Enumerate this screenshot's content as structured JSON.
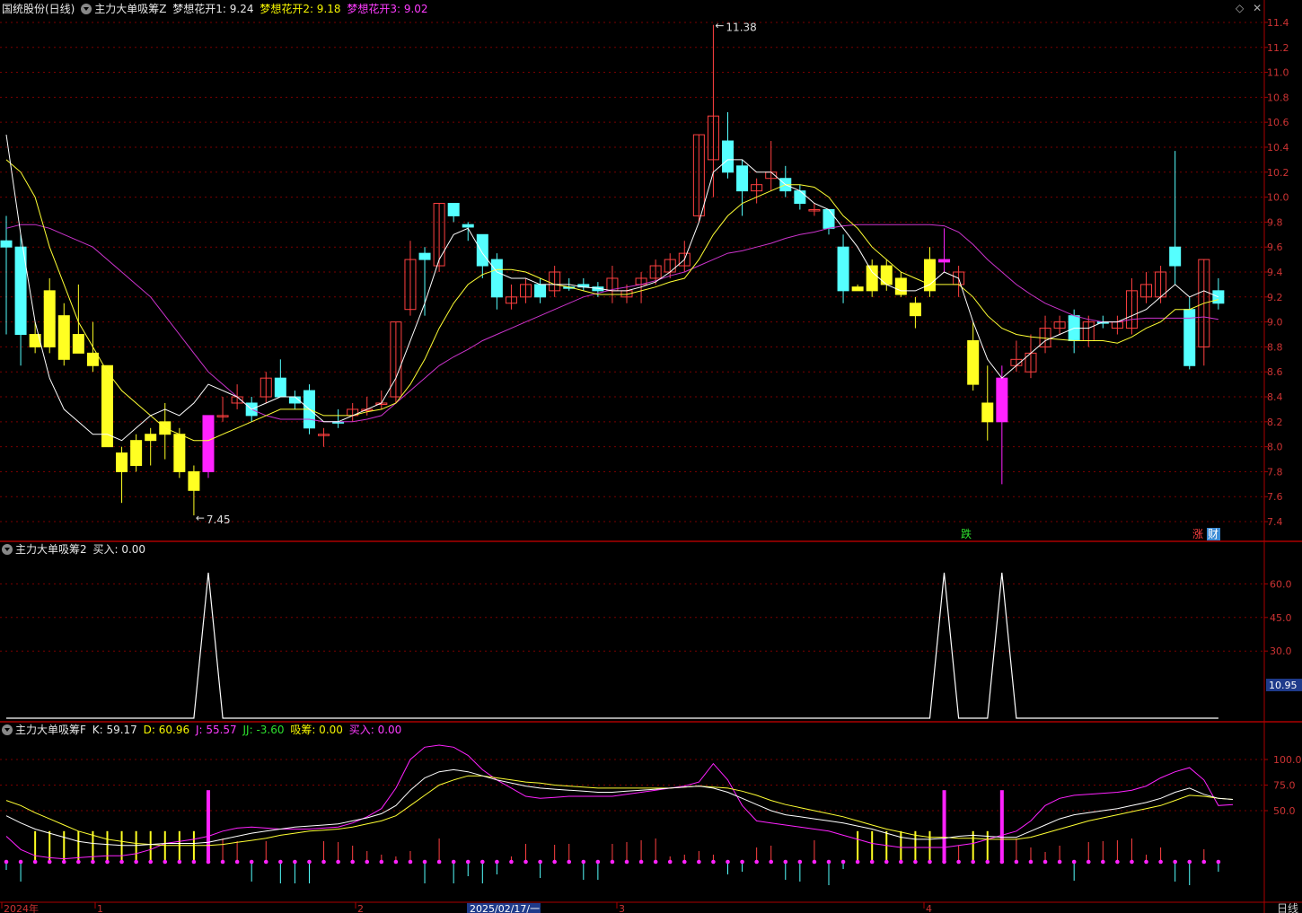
{
  "panel1": {
    "stock_name": "国统股份(日线)",
    "indicator_name": "主力大单吸筹Z",
    "ma1_label": "梦想花开1: 9.24",
    "ma2_label": "梦想花开2: 9.18",
    "ma3_label": "梦想花开3: 9.02",
    "high_marker": "11.38",
    "low_marker": "7.45",
    "y_ticks": [
      "11.4",
      "11.2",
      "11.0",
      "10.8",
      "10.6",
      "10.4",
      "10.2",
      "10.0",
      "9.8",
      "9.6",
      "9.4",
      "9.2",
      "9.0",
      "8.8",
      "8.6",
      "8.4",
      "8.2",
      "8.0",
      "7.8",
      "7.6",
      "7.4"
    ],
    "tag_die": "跌",
    "tag_zhang": "涨",
    "tag_cai": "财"
  },
  "panel2": {
    "indicator_name": "主力大单吸筹2",
    "buy_label": "买入: 0.00",
    "y_ticks": [
      "60.0",
      "45.0",
      "30.0"
    ],
    "current_value": "10.95"
  },
  "panel3": {
    "indicator_name": "主力大单吸筹F",
    "k_label": "K: 59.17",
    "d_label": "D: 60.96",
    "j_label": "J: 55.57",
    "jj_label": "JJ: -3.60",
    "xichou_label": "吸筹: 0.00",
    "buy_label": "买入: 0.00",
    "y_ticks": [
      "100.0",
      "75.0",
      "50.0"
    ]
  },
  "xaxis": {
    "labels": [
      "2024年",
      "1",
      "2",
      "2025/02/17/一",
      "3",
      "4"
    ],
    "period": "日线"
  },
  "colors": {
    "up": "#ff4040",
    "down": "#55ffff",
    "yellow_bar": "#ffff22",
    "magenta_bar": "#ff22ff",
    "ma1": "#ffffff",
    "ma2": "#ffff33",
    "ma3": "#cc33cc",
    "grid": "#7a0000"
  },
  "chart_data": {
    "type": "candlestick",
    "ylim": [
      7.35,
      11.45
    ],
    "candles": [
      {
        "o": 9.65,
        "h": 9.85,
        "l": 8.9,
        "c": 9.6,
        "k": "cyan"
      },
      {
        "o": 9.6,
        "h": 9.7,
        "l": 8.65,
        "c": 8.9,
        "k": "cyan"
      },
      {
        "o": 8.9,
        "h": 9.0,
        "l": 8.75,
        "c": 8.8,
        "k": "yellow"
      },
      {
        "o": 9.25,
        "h": 9.35,
        "l": 8.75,
        "c": 8.8,
        "k": "yellow"
      },
      {
        "o": 9.05,
        "h": 9.15,
        "l": 8.65,
        "c": 8.7,
        "k": "yellow"
      },
      {
        "o": 8.9,
        "h": 9.3,
        "l": 8.8,
        "c": 8.75,
        "k": "yellow"
      },
      {
        "o": 8.75,
        "h": 9.0,
        "l": 8.6,
        "c": 8.65,
        "k": "yellow"
      },
      {
        "o": 8.65,
        "h": 8.65,
        "l": 8.0,
        "c": 8.0,
        "k": "yellow"
      },
      {
        "o": 7.95,
        "h": 8.0,
        "l": 7.55,
        "c": 7.8,
        "k": "yellow"
      },
      {
        "o": 8.05,
        "h": 8.1,
        "l": 7.8,
        "c": 7.85,
        "k": "yellow"
      },
      {
        "o": 8.1,
        "h": 8.15,
        "l": 7.85,
        "c": 8.05,
        "k": "yellow"
      },
      {
        "o": 8.2,
        "h": 8.35,
        "l": 7.9,
        "c": 8.1,
        "k": "yellow"
      },
      {
        "o": 8.1,
        "h": 8.15,
        "l": 7.75,
        "c": 7.8,
        "k": "yellow"
      },
      {
        "o": 7.8,
        "h": 7.85,
        "l": 7.45,
        "c": 7.65,
        "k": "yellow"
      },
      {
        "o": 7.8,
        "h": 8.25,
        "l": 7.75,
        "c": 8.25,
        "k": "magenta"
      },
      {
        "o": 8.25,
        "h": 8.4,
        "l": 8.2,
        "c": 8.25,
        "k": "up"
      },
      {
        "o": 8.35,
        "h": 8.5,
        "l": 8.3,
        "c": 8.4,
        "k": "up"
      },
      {
        "o": 8.35,
        "h": 8.4,
        "l": 8.2,
        "c": 8.25,
        "k": "cyan"
      },
      {
        "o": 8.4,
        "h": 8.6,
        "l": 8.35,
        "c": 8.55,
        "k": "up"
      },
      {
        "o": 8.55,
        "h": 8.7,
        "l": 8.4,
        "c": 8.4,
        "k": "cyan"
      },
      {
        "o": 8.4,
        "h": 8.45,
        "l": 8.3,
        "c": 8.35,
        "k": "cyan"
      },
      {
        "o": 8.45,
        "h": 8.5,
        "l": 8.1,
        "c": 8.15,
        "k": "cyan"
      },
      {
        "o": 8.1,
        "h": 8.15,
        "l": 8.0,
        "c": 8.1,
        "k": "up"
      },
      {
        "o": 8.2,
        "h": 8.3,
        "l": 8.15,
        "c": 8.2,
        "k": "cyan"
      },
      {
        "o": 8.25,
        "h": 8.35,
        "l": 8.2,
        "c": 8.3,
        "k": "up"
      },
      {
        "o": 8.3,
        "h": 8.4,
        "l": 8.25,
        "c": 8.3,
        "k": "up"
      },
      {
        "o": 8.35,
        "h": 8.45,
        "l": 8.3,
        "c": 8.35,
        "k": "up"
      },
      {
        "o": 8.4,
        "h": 9.0,
        "l": 8.35,
        "c": 9.0,
        "k": "up"
      },
      {
        "o": 9.1,
        "h": 9.65,
        "l": 9.05,
        "c": 9.5,
        "k": "up"
      },
      {
        "o": 9.55,
        "h": 9.6,
        "l": 9.05,
        "c": 9.5,
        "k": "cyan"
      },
      {
        "o": 9.45,
        "h": 9.95,
        "l": 9.4,
        "c": 9.95,
        "k": "up"
      },
      {
        "o": 9.95,
        "h": 9.95,
        "l": 9.8,
        "c": 9.85,
        "k": "cyan"
      },
      {
        "o": 9.78,
        "h": 9.8,
        "l": 9.65,
        "c": 9.76,
        "k": "cyan"
      },
      {
        "o": 9.7,
        "h": 9.7,
        "l": 9.35,
        "c": 9.45,
        "k": "cyan"
      },
      {
        "o": 9.5,
        "h": 9.55,
        "l": 9.1,
        "c": 9.2,
        "k": "cyan"
      },
      {
        "o": 9.15,
        "h": 9.3,
        "l": 9.1,
        "c": 9.2,
        "k": "up"
      },
      {
        "o": 9.2,
        "h": 9.35,
        "l": 9.15,
        "c": 9.3,
        "k": "up"
      },
      {
        "o": 9.3,
        "h": 9.35,
        "l": 9.15,
        "c": 9.2,
        "k": "cyan"
      },
      {
        "o": 9.25,
        "h": 9.45,
        "l": 9.2,
        "c": 9.4,
        "k": "up"
      },
      {
        "o": 9.28,
        "h": 9.35,
        "l": 9.25,
        "c": 9.28,
        "k": "cyan"
      },
      {
        "o": 9.3,
        "h": 9.35,
        "l": 9.25,
        "c": 9.28,
        "k": "cyan"
      },
      {
        "o": 9.28,
        "h": 9.32,
        "l": 9.2,
        "c": 9.25,
        "k": "cyan"
      },
      {
        "o": 9.25,
        "h": 9.45,
        "l": 9.15,
        "c": 9.35,
        "k": "up"
      },
      {
        "o": 9.2,
        "h": 9.3,
        "l": 9.15,
        "c": 9.25,
        "k": "up"
      },
      {
        "o": 9.3,
        "h": 9.4,
        "l": 9.15,
        "c": 9.35,
        "k": "up"
      },
      {
        "o": 9.35,
        "h": 9.5,
        "l": 9.3,
        "c": 9.45,
        "k": "up"
      },
      {
        "o": 9.4,
        "h": 9.55,
        "l": 9.35,
        "c": 9.5,
        "k": "up"
      },
      {
        "o": 9.45,
        "h": 9.65,
        "l": 9.4,
        "c": 9.55,
        "k": "up"
      },
      {
        "o": 9.85,
        "h": 10.5,
        "l": 9.8,
        "c": 10.5,
        "k": "up"
      },
      {
        "o": 10.3,
        "h": 11.38,
        "l": 10.0,
        "c": 10.65,
        "k": "up"
      },
      {
        "o": 10.45,
        "h": 10.68,
        "l": 10.15,
        "c": 10.2,
        "k": "cyan"
      },
      {
        "o": 10.25,
        "h": 10.3,
        "l": 9.85,
        "c": 10.05,
        "k": "cyan"
      },
      {
        "o": 10.05,
        "h": 10.15,
        "l": 9.95,
        "c": 10.1,
        "k": "up"
      },
      {
        "o": 10.15,
        "h": 10.45,
        "l": 10.05,
        "c": 10.2,
        "k": "up"
      },
      {
        "o": 10.15,
        "h": 10.25,
        "l": 10.0,
        "c": 10.05,
        "k": "cyan"
      },
      {
        "o": 10.05,
        "h": 10.1,
        "l": 9.9,
        "c": 9.95,
        "k": "cyan"
      },
      {
        "o": 9.9,
        "h": 9.95,
        "l": 9.85,
        "c": 9.9,
        "k": "up"
      },
      {
        "o": 9.9,
        "h": 9.9,
        "l": 9.7,
        "c": 9.75,
        "k": "cyan"
      },
      {
        "o": 9.6,
        "h": 9.7,
        "l": 9.15,
        "c": 9.25,
        "k": "cyan"
      },
      {
        "o": 9.28,
        "h": 9.3,
        "l": 9.25,
        "c": 9.25,
        "k": "yellow"
      },
      {
        "o": 9.45,
        "h": 9.5,
        "l": 9.2,
        "c": 9.25,
        "k": "yellow"
      },
      {
        "o": 9.45,
        "h": 9.5,
        "l": 9.25,
        "c": 9.3,
        "k": "yellow"
      },
      {
        "o": 9.35,
        "h": 9.4,
        "l": 9.2,
        "c": 9.22,
        "k": "yellow"
      },
      {
        "o": 9.15,
        "h": 9.2,
        "l": 8.95,
        "c": 9.05,
        "k": "yellow"
      },
      {
        "o": 9.5,
        "h": 9.6,
        "l": 9.2,
        "c": 9.25,
        "k": "yellow"
      },
      {
        "o": 9.5,
        "h": 9.75,
        "l": 9.4,
        "c": 9.48,
        "k": "magenta"
      },
      {
        "o": 9.3,
        "h": 9.45,
        "l": 9.2,
        "c": 9.4,
        "k": "up"
      },
      {
        "o": 8.85,
        "h": 9.0,
        "l": 8.45,
        "c": 8.5,
        "k": "yellow"
      },
      {
        "o": 8.35,
        "h": 8.65,
        "l": 8.05,
        "c": 8.2,
        "k": "yellow"
      },
      {
        "o": 8.2,
        "h": 8.65,
        "l": 7.7,
        "c": 8.55,
        "k": "magenta"
      },
      {
        "o": 8.65,
        "h": 8.85,
        "l": 8.6,
        "c": 8.7,
        "k": "up"
      },
      {
        "o": 8.6,
        "h": 8.9,
        "l": 8.55,
        "c": 8.75,
        "k": "up"
      },
      {
        "o": 8.8,
        "h": 9.05,
        "l": 8.75,
        "c": 8.95,
        "k": "up"
      },
      {
        "o": 8.95,
        "h": 9.05,
        "l": 8.9,
        "c": 9.0,
        "k": "up"
      },
      {
        "o": 9.05,
        "h": 9.1,
        "l": 8.75,
        "c": 8.85,
        "k": "cyan"
      },
      {
        "o": 8.85,
        "h": 9.05,
        "l": 8.8,
        "c": 9.0,
        "k": "up"
      },
      {
        "o": 9.0,
        "h": 9.05,
        "l": 8.95,
        "c": 9.0,
        "k": "cyan"
      },
      {
        "o": 8.95,
        "h": 9.05,
        "l": 8.9,
        "c": 9.0,
        "k": "up"
      },
      {
        "o": 8.95,
        "h": 9.35,
        "l": 8.9,
        "c": 9.25,
        "k": "up"
      },
      {
        "o": 9.2,
        "h": 9.4,
        "l": 9.15,
        "c": 9.3,
        "k": "up"
      },
      {
        "o": 9.2,
        "h": 9.45,
        "l": 9.15,
        "c": 9.4,
        "k": "up"
      },
      {
        "o": 9.6,
        "h": 10.37,
        "l": 9.3,
        "c": 9.45,
        "k": "cyan"
      },
      {
        "o": 9.1,
        "h": 9.2,
        "l": 8.62,
        "c": 8.65,
        "k": "cyan"
      },
      {
        "o": 8.8,
        "h": 9.5,
        "l": 8.65,
        "c": 9.5,
        "k": "up"
      },
      {
        "o": 9.25,
        "h": 9.35,
        "l": 9.1,
        "c": 9.15,
        "k": "cyan"
      }
    ],
    "ma1": [
      10.5,
      9.7,
      9.0,
      8.55,
      8.3,
      8.2,
      8.1,
      8.1,
      8.05,
      8.15,
      8.25,
      8.3,
      8.25,
      8.35,
      8.5,
      8.45,
      8.4,
      8.3,
      8.35,
      8.4,
      8.4,
      8.3,
      8.2,
      8.2,
      8.25,
      8.3,
      8.35,
      8.55,
      8.85,
      9.15,
      9.5,
      9.7,
      9.75,
      9.55,
      9.4,
      9.35,
      9.35,
      9.3,
      9.3,
      9.3,
      9.28,
      9.27,
      9.25,
      9.25,
      9.28,
      9.32,
      9.4,
      9.5,
      9.8,
      10.2,
      10.3,
      10.3,
      10.2,
      10.2,
      10.1,
      10.05,
      9.95,
      9.9,
      9.75,
      9.6,
      9.4,
      9.3,
      9.25,
      9.25,
      9.3,
      9.4,
      9.35,
      9.0,
      8.7,
      8.55,
      8.65,
      8.75,
      8.85,
      8.9,
      8.95,
      8.95,
      9.0,
      9.0,
      9.05,
      9.1,
      9.2,
      9.3,
      9.2,
      9.25,
      9.2
    ],
    "ma2": [
      10.3,
      10.2,
      10.0,
      9.6,
      9.3,
      9.0,
      8.8,
      8.6,
      8.45,
      8.35,
      8.25,
      8.15,
      8.1,
      8.05,
      8.05,
      8.1,
      8.15,
      8.2,
      8.25,
      8.3,
      8.3,
      8.3,
      8.25,
      8.25,
      8.25,
      8.28,
      8.3,
      8.35,
      8.5,
      8.7,
      8.95,
      9.15,
      9.3,
      9.38,
      9.42,
      9.42,
      9.4,
      9.35,
      9.3,
      9.28,
      9.25,
      9.22,
      9.22,
      9.22,
      9.25,
      9.28,
      9.32,
      9.35,
      9.5,
      9.7,
      9.85,
      9.95,
      10.0,
      10.05,
      10.1,
      10.1,
      10.08,
      10.0,
      9.85,
      9.75,
      9.6,
      9.5,
      9.4,
      9.35,
      9.3,
      9.3,
      9.3,
      9.2,
      9.05,
      8.95,
      8.9,
      8.88,
      8.87,
      8.86,
      8.85,
      8.85,
      8.85,
      8.83,
      8.88,
      8.95,
      9.0,
      9.1,
      9.1,
      9.15,
      9.18
    ],
    "ma3": [
      9.75,
      9.78,
      9.78,
      9.75,
      9.7,
      9.65,
      9.6,
      9.5,
      9.4,
      9.3,
      9.2,
      9.05,
      8.9,
      8.75,
      8.6,
      8.5,
      8.4,
      8.3,
      8.25,
      8.22,
      8.22,
      8.22,
      8.2,
      8.2,
      8.2,
      8.22,
      8.25,
      8.35,
      8.45,
      8.55,
      8.65,
      8.72,
      8.78,
      8.85,
      8.9,
      8.95,
      9.0,
      9.05,
      9.1,
      9.15,
      9.2,
      9.23,
      9.26,
      9.28,
      9.3,
      9.33,
      9.37,
      9.4,
      9.45,
      9.5,
      9.55,
      9.57,
      9.6,
      9.63,
      9.67,
      9.7,
      9.72,
      9.75,
      9.77,
      9.78,
      9.78,
      9.78,
      9.78,
      9.78,
      9.78,
      9.77,
      9.72,
      9.62,
      9.5,
      9.4,
      9.3,
      9.22,
      9.15,
      9.1,
      9.05,
      9.02,
      9.0,
      9.0,
      9.02,
      9.03,
      9.03,
      9.03,
      9.03,
      9.04,
      9.02
    ],
    "panel2_spikes": [
      14,
      65,
      69
    ],
    "panel2_peak": 65,
    "kdj": {
      "k": [
        45,
        38,
        32,
        28,
        24,
        20,
        18,
        17,
        16,
        16,
        17,
        18,
        18,
        18,
        19,
        22,
        25,
        28,
        30,
        32,
        34,
        35,
        36,
        37,
        40,
        43,
        47,
        55,
        70,
        82,
        88,
        90,
        88,
        84,
        80,
        77,
        74,
        72,
        71,
        70,
        69,
        68,
        68,
        69,
        70,
        71,
        72,
        73,
        74,
        72,
        68,
        62,
        56,
        50,
        46,
        44,
        42,
        40,
        38,
        35,
        32,
        28,
        24,
        22,
        22,
        23,
        25,
        26,
        25,
        24,
        24,
        30,
        36,
        42,
        46,
        48,
        50,
        52,
        55,
        58,
        62,
        68,
        72,
        66,
        62,
        61
      ],
      "d": [
        60,
        55,
        48,
        42,
        36,
        30,
        26,
        22,
        20,
        18,
        17,
        16,
        16,
        16,
        16,
        17,
        19,
        21,
        23,
        26,
        28,
        30,
        31,
        32,
        34,
        37,
        40,
        45,
        55,
        65,
        75,
        80,
        84,
        84,
        82,
        80,
        78,
        77,
        75,
        74,
        73,
        72,
        72,
        72,
        72,
        72,
        72,
        73,
        74,
        73,
        72,
        69,
        65,
        60,
        56,
        53,
        50,
        47,
        44,
        40,
        36,
        32,
        29,
        26,
        24,
        24,
        23,
        23,
        22,
        22,
        22,
        24,
        28,
        32,
        36,
        40,
        43,
        46,
        49,
        52,
        55,
        60,
        65,
        64,
        62,
        61
      ],
      "j": [
        25,
        12,
        6,
        4,
        3,
        4,
        5,
        6,
        6,
        8,
        12,
        18,
        20,
        22,
        25,
        30,
        33,
        34,
        33,
        32,
        32,
        32,
        33,
        34,
        38,
        44,
        52,
        72,
        100,
        112,
        114,
        112,
        104,
        90,
        80,
        72,
        64,
        62,
        63,
        64,
        64,
        64,
        64,
        66,
        68,
        70,
        72,
        74,
        78,
        96,
        80,
        55,
        40,
        38,
        36,
        34,
        32,
        30,
        26,
        22,
        18,
        16,
        14,
        14,
        14,
        14,
        16,
        18,
        22,
        26,
        30,
        40,
        55,
        62,
        65,
        66,
        67,
        68,
        70,
        74,
        82,
        88,
        92,
        80,
        55,
        56
      ]
    }
  }
}
